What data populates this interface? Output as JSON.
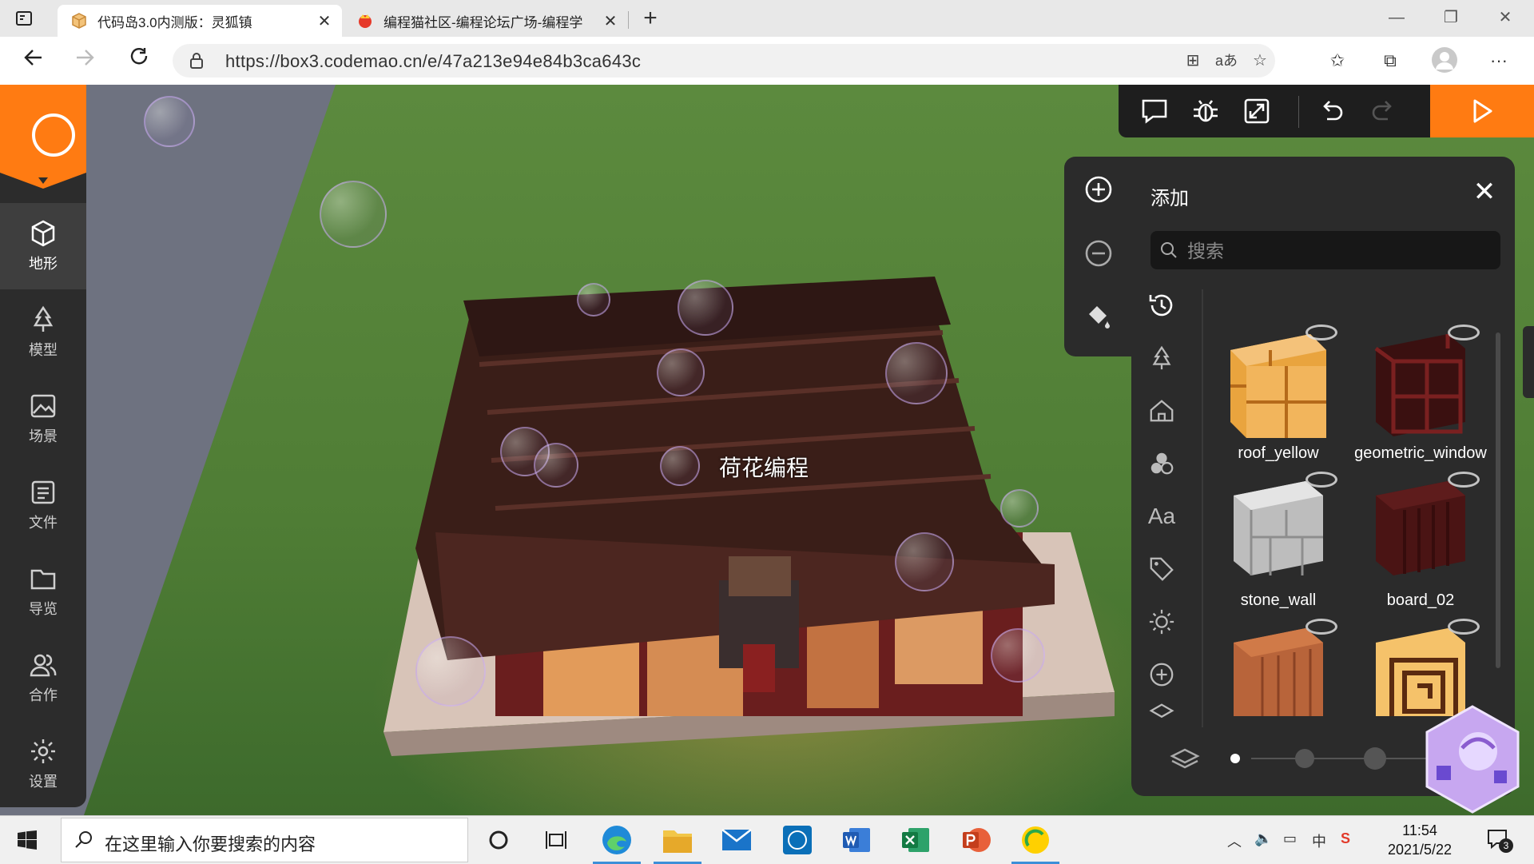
{
  "browser": {
    "tabs": [
      {
        "title": "代码岛3.0内测版：灵狐镇",
        "active": true
      },
      {
        "title": "编程猫社区-编程论坛广场-编程学",
        "active": false
      }
    ],
    "url": "https://box3.codemao.cn/e/47a213e94e84b3ca643c",
    "read_aloud_icon_text": "aあ"
  },
  "sidebar": {
    "items": [
      {
        "label": "地形",
        "icon": "cube-icon",
        "active": true
      },
      {
        "label": "模型",
        "icon": "tree-icon",
        "active": false
      },
      {
        "label": "场景",
        "icon": "image-icon",
        "active": false
      },
      {
        "label": "文件",
        "icon": "document-icon",
        "active": false
      },
      {
        "label": "导览",
        "icon": "folder-icon",
        "active": false
      },
      {
        "label": "合作",
        "icon": "users-icon",
        "active": false
      },
      {
        "label": "设置",
        "icon": "gear-icon",
        "active": false
      }
    ]
  },
  "scene": {
    "player_name": "荷花编程"
  },
  "panel": {
    "title": "添加",
    "search_placeholder": "搜索",
    "categories": [
      "history-icon",
      "tree-icon",
      "house-icon",
      "shapes-icon",
      "text-icon",
      "tag-icon",
      "sun-icon",
      "plus-circle-icon",
      "layers-icon"
    ],
    "category_text_label": "Aa",
    "items": [
      {
        "name": "roof_yellow",
        "color": "#e9a43e"
      },
      {
        "name": "geometric_window",
        "color": "#5a1818"
      },
      {
        "name": "stone_wall",
        "color": "#cfcfcf"
      },
      {
        "name": "board_02",
        "color": "#4a1414"
      },
      {
        "name": "",
        "color": "#b8643a"
      },
      {
        "name": "",
        "color": "#c9822a"
      }
    ],
    "brush_size_level": 1,
    "brush_size_levels": 4
  },
  "taskbar": {
    "search_placeholder": "在这里输入你要搜索的内容",
    "time": "11:54",
    "date": "2021/5/22",
    "ime": "中",
    "notifications": "3"
  },
  "colors": {
    "accent": "#ff7b12",
    "panel_bg": "#2b2b2b",
    "sidebar_bg": "#2c2c2c"
  }
}
